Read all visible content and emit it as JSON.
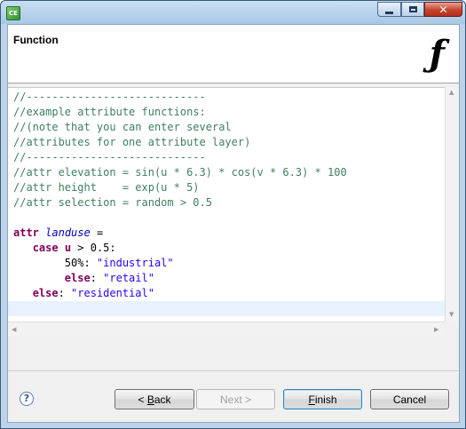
{
  "window": {
    "app_icon_text": "CE",
    "controls": {
      "minimize": "minimize",
      "maximize": "maximize",
      "close": "close"
    }
  },
  "header": {
    "title": "Function",
    "icon_glyph": "ƒ"
  },
  "editor": {
    "lines": [
      [
        {
          "t": "//----------------------------",
          "c": "comment"
        }
      ],
      [
        {
          "t": "//example attribute functions:",
          "c": "comment"
        }
      ],
      [
        {
          "t": "//(note that you can enter several",
          "c": "comment"
        }
      ],
      [
        {
          "t": "//attributes for one attribute layer)",
          "c": "comment"
        }
      ],
      [
        {
          "t": "//----------------------------",
          "c": "comment"
        }
      ],
      [
        {
          "t": "//attr elevation = sin(u * 6.3) * cos(v * 6.3) * 100",
          "c": "comment"
        }
      ],
      [
        {
          "t": "//attr height    = exp(u * 5)",
          "c": "comment"
        }
      ],
      [
        {
          "t": "//attr selection = random > 0.5",
          "c": "comment"
        }
      ],
      [
        {
          "t": "",
          "c": ""
        }
      ],
      [
        {
          "t": "attr",
          "c": "kw"
        },
        {
          "t": " ",
          "c": ""
        },
        {
          "t": "landuse",
          "c": "ident"
        },
        {
          "t": " =",
          "c": ""
        }
      ],
      [
        {
          "t": "   ",
          "c": ""
        },
        {
          "t": "case",
          "c": "kw"
        },
        {
          "t": " ",
          "c": ""
        },
        {
          "t": "u",
          "c": "kw"
        },
        {
          "t": " > 0.5:",
          "c": ""
        }
      ],
      [
        {
          "t": "        50%: ",
          "c": ""
        },
        {
          "t": "\"industrial\"",
          "c": "str"
        }
      ],
      [
        {
          "t": "        ",
          "c": ""
        },
        {
          "t": "else",
          "c": "kw"
        },
        {
          "t": ": ",
          "c": ""
        },
        {
          "t": "\"retail\"",
          "c": "str"
        }
      ],
      [
        {
          "t": "   ",
          "c": ""
        },
        {
          "t": "else",
          "c": "kw"
        },
        {
          "t": ": ",
          "c": ""
        },
        {
          "t": "\"residential\"",
          "c": "str"
        }
      ],
      [
        {
          "t": "",
          "c": ""
        }
      ]
    ]
  },
  "footer": {
    "help_glyph": "?",
    "back": {
      "mnemonic": "B",
      "prefix": "< ",
      "rest": "ack"
    },
    "next": "Next >",
    "finish": {
      "mnemonic": "F",
      "rest": "inish"
    },
    "cancel": "Cancel"
  },
  "colors": {
    "comment": "#3f7f5f",
    "keyword": "#7f0055",
    "identifier": "#0000c0",
    "string": "#2a00ff",
    "current_line": "#e8f2fe"
  }
}
